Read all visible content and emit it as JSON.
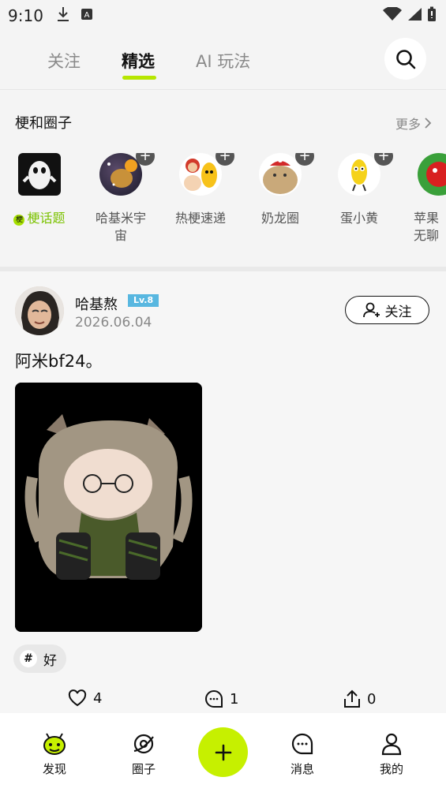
{
  "status_bar": {
    "time": "9:10"
  },
  "top_tabs": [
    {
      "label": "关注",
      "active": false
    },
    {
      "label": "精选",
      "active": true
    },
    {
      "label": "AI 玩法",
      "active": false
    }
  ],
  "circles": {
    "title": "梗和圈子",
    "more": "更多",
    "items": [
      {
        "label": "梗话题",
        "tag": "梗"
      },
      {
        "label": "哈基米宇宙"
      },
      {
        "label": "热梗速递"
      },
      {
        "label": "奶龙圈"
      },
      {
        "label": "蛋小黄"
      },
      {
        "label": "苹果无聊"
      }
    ]
  },
  "post": {
    "username": "哈基熬",
    "level": "Lv.8",
    "date": "2026.06.04",
    "follow_label": "关注",
    "text": "阿米bf24。",
    "hashtag": "好",
    "likes": "4",
    "comments": "1",
    "shares": "0"
  },
  "bottom_nav": [
    {
      "label": "发现"
    },
    {
      "label": "圈子"
    },
    {
      "label": "消息"
    },
    {
      "label": "我的"
    }
  ],
  "colors": {
    "accent": "#c6f000",
    "level_badge": "#58b7e0"
  }
}
